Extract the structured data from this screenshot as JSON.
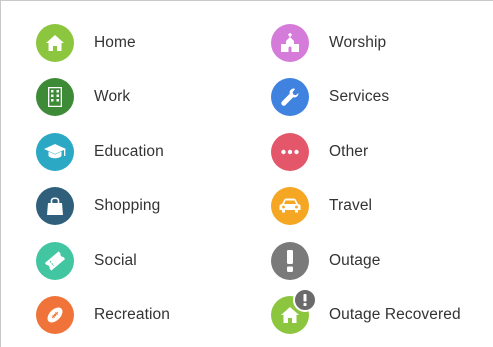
{
  "categories": {
    "left": [
      {
        "label": "Home",
        "icon": "home-icon",
        "color": "#8cc63f"
      },
      {
        "label": "Work",
        "icon": "building-icon",
        "color": "#3d8b37"
      },
      {
        "label": "Education",
        "icon": "graduation-cap-icon",
        "color": "#2aa8c4"
      },
      {
        "label": "Shopping",
        "icon": "shopping-bag-icon",
        "color": "#2f5f7a"
      },
      {
        "label": "Social",
        "icon": "ticket-icon",
        "color": "#42c6a1"
      },
      {
        "label": "Recreation",
        "icon": "football-icon",
        "color": "#f0743a"
      }
    ],
    "right": [
      {
        "label": "Worship",
        "icon": "church-icon",
        "color": "#d57bd9"
      },
      {
        "label": "Services",
        "icon": "wrench-icon",
        "color": "#3f82e0"
      },
      {
        "label": "Other",
        "icon": "ellipsis-icon",
        "color": "#e4566a"
      },
      {
        "label": "Travel",
        "icon": "car-icon",
        "color": "#f5a623"
      },
      {
        "label": "Outage",
        "icon": "exclamation-icon",
        "color": "#7a7a7a"
      },
      {
        "label": "Outage Recovered",
        "icon": "home-icon",
        "color": "#8cc63f",
        "badge_icon": "exclamation-badge-icon"
      }
    ]
  }
}
